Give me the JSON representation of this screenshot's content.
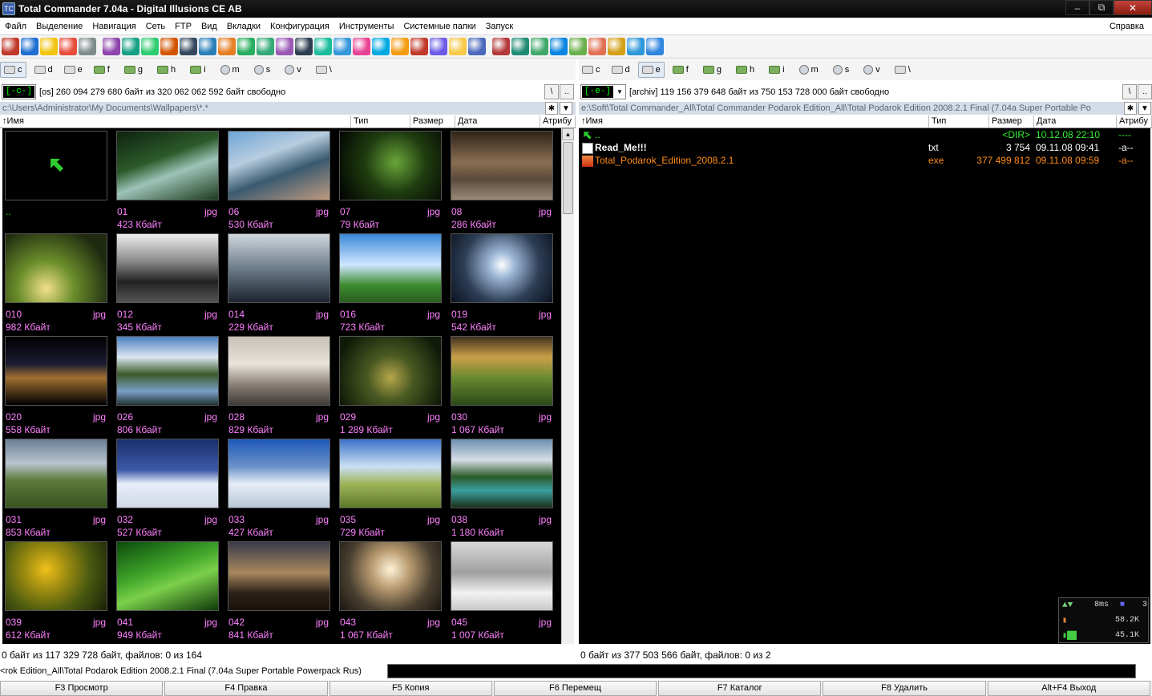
{
  "window": {
    "title": "Total Commander 7.04a - Digital Illusions CE AB"
  },
  "menu": {
    "items": [
      "Файл",
      "Выделение",
      "Навигация",
      "Сеть",
      "FTP",
      "Вид",
      "Вкладки",
      "Конфигурация",
      "Инструменты",
      "Системные папки",
      "Запуск"
    ],
    "help": "Справка"
  },
  "toolbar": {
    "icons": [
      "package-icon",
      "ie-icon",
      "radiation-icon",
      "lifebuoy-icon",
      "tools-icon",
      "compare-icon",
      "puzzle-icon",
      "mail-icon",
      "cross-tool-icon",
      "layers-icon",
      "gear-icon",
      "hand-icon",
      "chart-icon",
      "green-chart-icon",
      "bug-icon",
      "monitor-icon",
      "disc-icon",
      "network-icon",
      "swirl-icon",
      "globe-icon",
      "mail-box-icon",
      "blocked-icon",
      "users-icon",
      "folder-icon",
      "panel-icon",
      "split-icon",
      "sync-icon",
      "recycle-icon",
      "windows-icon",
      "settings-icon",
      "colors-icon",
      "tool-icon",
      "info-icon",
      "earth-icon"
    ]
  },
  "left": {
    "drives": [
      "c",
      "d",
      "e",
      "f",
      "g",
      "h",
      "i",
      "m",
      "s",
      "v",
      "\\"
    ],
    "active_drive": "c",
    "combo_label": "[-c-]",
    "free_info": "[os]  260 094 279 680 байт из 320 062 062 592 байт свободно",
    "path": "c:\\Users\\Administrator\\My Documents\\Wallpapers\\*.*",
    "columns": [
      "↑Имя",
      "Тип",
      "Размер",
      "Дата",
      "Атрибу"
    ],
    "thumbs": [
      {
        "name": "..",
        "ext": "",
        "size": ""
      },
      {
        "name": "01",
        "ext": "jpg",
        "size": "423 Кбайт"
      },
      {
        "name": "06",
        "ext": "jpg",
        "size": "530 Кбайт"
      },
      {
        "name": "07",
        "ext": "jpg",
        "size": "79 Кбайт"
      },
      {
        "name": "08",
        "ext": "jpg",
        "size": "286 Кбайт"
      },
      {
        "name": "010",
        "ext": "jpg",
        "size": "982 Кбайт"
      },
      {
        "name": "012",
        "ext": "jpg",
        "size": "345 Кбайт"
      },
      {
        "name": "014",
        "ext": "jpg",
        "size": "229 Кбайт"
      },
      {
        "name": "016",
        "ext": "jpg",
        "size": "723 Кбайт"
      },
      {
        "name": "019",
        "ext": "jpg",
        "size": "542 Кбайт"
      },
      {
        "name": "020",
        "ext": "jpg",
        "size": "558 Кбайт"
      },
      {
        "name": "026",
        "ext": "jpg",
        "size": "806 Кбайт"
      },
      {
        "name": "028",
        "ext": "jpg",
        "size": "829 Кбайт"
      },
      {
        "name": "029",
        "ext": "jpg",
        "size": "1 289 Кбайт"
      },
      {
        "name": "030",
        "ext": "jpg",
        "size": "1 067 Кбайт"
      },
      {
        "name": "031",
        "ext": "jpg",
        "size": "853 Кбайт"
      },
      {
        "name": "032",
        "ext": "jpg",
        "size": "527 Кбайт"
      },
      {
        "name": "033",
        "ext": "jpg",
        "size": "427 Кбайт"
      },
      {
        "name": "035",
        "ext": "jpg",
        "size": "729 Кбайт"
      },
      {
        "name": "038",
        "ext": "jpg",
        "size": "1 180 Кбайт"
      },
      {
        "name": "039",
        "ext": "jpg",
        "size": "612 Кбайт"
      },
      {
        "name": "041",
        "ext": "jpg",
        "size": "949 Кбайт"
      },
      {
        "name": "042",
        "ext": "jpg",
        "size": "841 Кбайт"
      },
      {
        "name": "043",
        "ext": "jpg",
        "size": "1 067 Кбайт"
      },
      {
        "name": "045",
        "ext": "jpg",
        "size": "1 007 Кбайт"
      }
    ],
    "status": "0 байт из 117 329 728 байт, файлов: 0 из 164"
  },
  "right": {
    "drives": [
      "c",
      "d",
      "e",
      "f",
      "g",
      "h",
      "i",
      "m",
      "s",
      "v",
      "\\"
    ],
    "active_drive": "e",
    "combo_label": "[-e-]",
    "free_info": "[archiv]  119 156 379 648 байт из 750 153 728 000 байт свободно",
    "path": "e:\\Soft\\Total Commander_All\\Total Commander Podarok Edition_All\\Total Podarok Edition 2008.2.1 Final (7.04a Super Portable Po",
    "columns": [
      "↑Имя",
      "Тип",
      "Размер",
      "Дата",
      "Атрибу"
    ],
    "files": [
      {
        "name": "..",
        "type": "",
        "size": "<DIR>",
        "date": "10.12.08 22:10",
        "attr": "----",
        "color": "#33ee33"
      },
      {
        "name": "Read_Me!!!",
        "type": "txt",
        "size": "3 754",
        "date": "09.11.08 09:41",
        "attr": "-a--",
        "color": "#ffffff"
      },
      {
        "name": "Total_Podarok_Edition_2008.2.1",
        "type": "exe",
        "size": "377 499 812",
        "date": "09.11.08 09:59",
        "attr": "-a--",
        "color": "#ff8c1a"
      }
    ],
    "status": "0 байт из 377 503 566 байт, файлов: 0 из 2"
  },
  "cmdline": {
    "path": "rok Edition_All\\Total Podarok Edition 2008.2.1 Final (7.04a Super Portable Powerpack Rus)>"
  },
  "fkeys": [
    "F3 Просмотр",
    "F4 Правка",
    "F5 Копия",
    "F6 Перемещ",
    "F7 Каталог",
    "F8 Удалить",
    "Alt+F4 Выход"
  ],
  "netmon": {
    "ping": "8ms",
    "count": "3",
    "down": "58.2K",
    "up": "45.1K"
  },
  "colors": {
    "file_text": "#ff80ff",
    "dir_up": "#33ee33",
    "exe": "#ff8c1a",
    "panel_bg": "#000000"
  }
}
